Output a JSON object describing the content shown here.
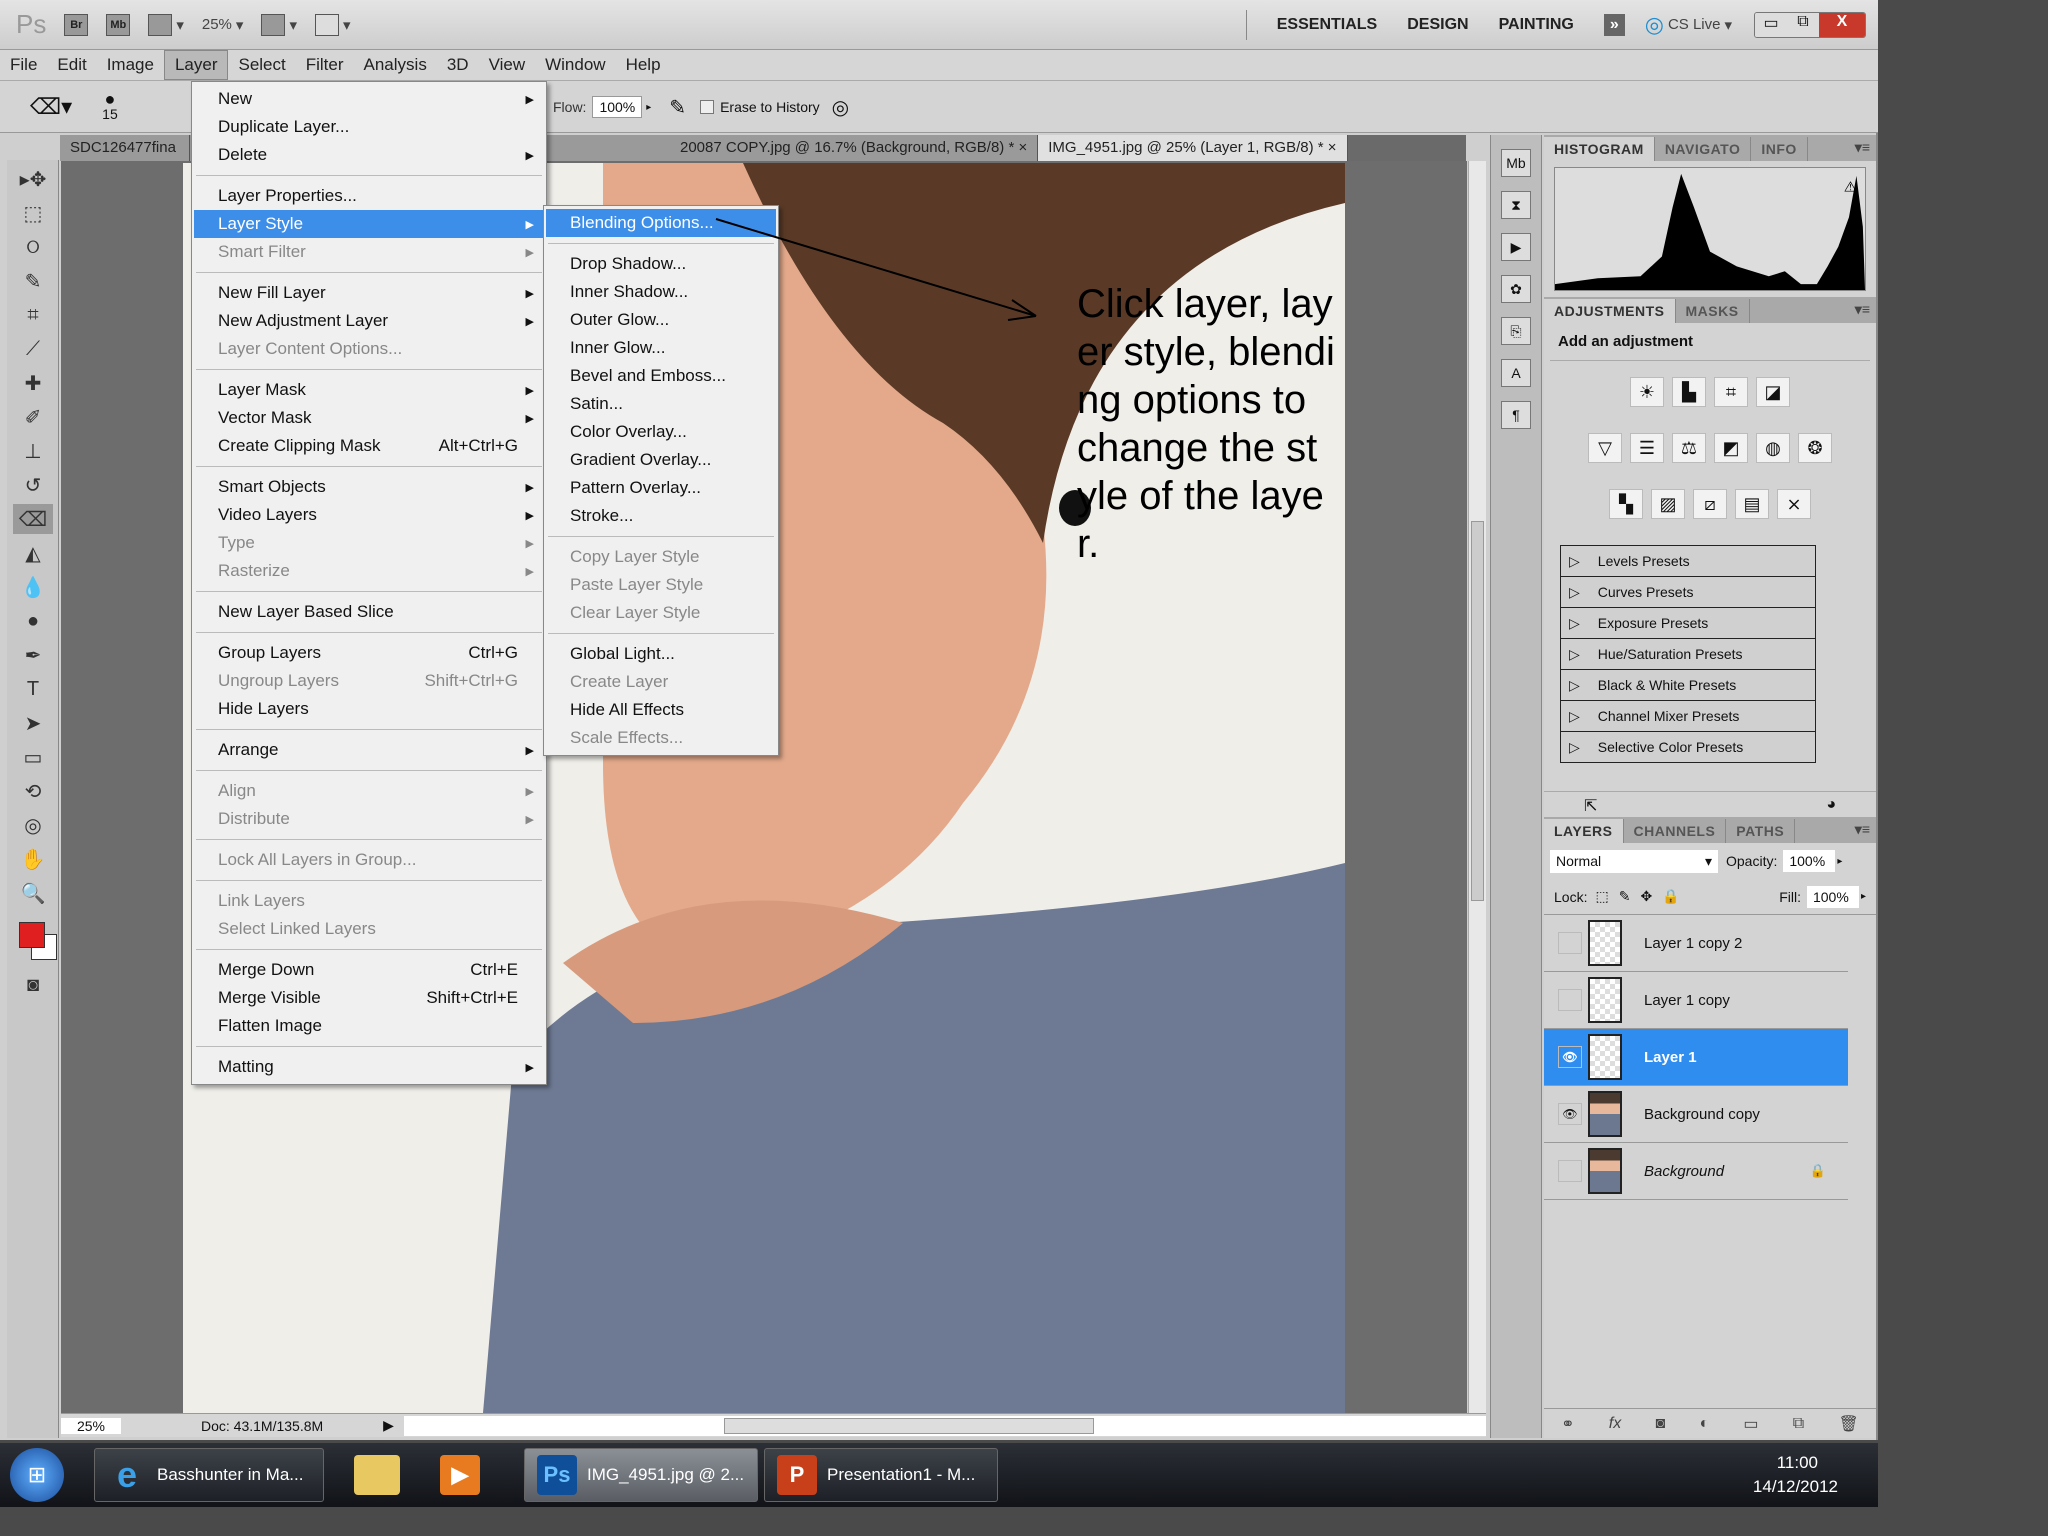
{
  "appbar": {
    "logo": "Ps",
    "bridge": "Br",
    "minibridge": "Mb",
    "zoom": "25%",
    "workspaces": [
      "ESSENTIALS",
      "DESIGN",
      "PAINTING"
    ],
    "more": "»",
    "cslive": "CS Live",
    "win_min": "▭",
    "win_restore": "⧉",
    "win_close": "X"
  },
  "menubar": [
    "File",
    "Edit",
    "Image",
    "Layer",
    "Select",
    "Filter",
    "Analysis",
    "3D",
    "View",
    "Window",
    "Help"
  ],
  "options": {
    "brush_size": "15",
    "flow_label": "Flow:",
    "flow_value": "100%",
    "erase_history": "Erase to History"
  },
  "tabs": [
    "SDC126477fina",
    "20087 COPY.jpg @ 16.7% (Background, RGB/8) *",
    "IMG_4951.jpg @ 25% (Layer 1, RGB/8) *"
  ],
  "tab_close": "×",
  "layer_menu": [
    {
      "label": "New",
      "sub": true
    },
    {
      "label": "Duplicate Layer..."
    },
    {
      "label": "Delete",
      "sub": true
    },
    {
      "sep": true
    },
    {
      "label": "Layer Properties..."
    },
    {
      "label": "Layer Style",
      "sub": true,
      "hl": true
    },
    {
      "label": "Smart Filter",
      "sub": true,
      "dis": true
    },
    {
      "sep": true
    },
    {
      "label": "New Fill Layer",
      "sub": true
    },
    {
      "label": "New Adjustment Layer",
      "sub": true
    },
    {
      "label": "Layer Content Options...",
      "dis": true
    },
    {
      "sep": true
    },
    {
      "label": "Layer Mask",
      "sub": true
    },
    {
      "label": "Vector Mask",
      "sub": true
    },
    {
      "label": "Create Clipping Mask",
      "shortcut": "Alt+Ctrl+G"
    },
    {
      "sep": true
    },
    {
      "label": "Smart Objects",
      "sub": true
    },
    {
      "label": "Video Layers",
      "sub": true
    },
    {
      "label": "Type",
      "sub": true,
      "dis": true
    },
    {
      "label": "Rasterize",
      "sub": true,
      "dis": true
    },
    {
      "sep": true
    },
    {
      "label": "New Layer Based Slice"
    },
    {
      "sep": true
    },
    {
      "label": "Group Layers",
      "shortcut": "Ctrl+G"
    },
    {
      "label": "Ungroup Layers",
      "shortcut": "Shift+Ctrl+G",
      "dis": true
    },
    {
      "label": "Hide Layers"
    },
    {
      "sep": true
    },
    {
      "label": "Arrange",
      "sub": true
    },
    {
      "sep": true
    },
    {
      "label": "Align",
      "sub": true,
      "dis": true
    },
    {
      "label": "Distribute",
      "sub": true,
      "dis": true
    },
    {
      "sep": true
    },
    {
      "label": "Lock All Layers in Group...",
      "dis": true
    },
    {
      "sep": true
    },
    {
      "label": "Link Layers",
      "dis": true
    },
    {
      "label": "Select Linked Layers",
      "dis": true
    },
    {
      "sep": true
    },
    {
      "label": "Merge Down",
      "shortcut": "Ctrl+E"
    },
    {
      "label": "Merge Visible",
      "shortcut": "Shift+Ctrl+E"
    },
    {
      "label": "Flatten Image"
    },
    {
      "sep": true
    },
    {
      "label": "Matting",
      "sub": true
    }
  ],
  "style_menu": [
    {
      "label": "Blending Options...",
      "hl": true
    },
    {
      "sep": true
    },
    {
      "label": "Drop Shadow..."
    },
    {
      "label": "Inner Shadow..."
    },
    {
      "label": "Outer Glow..."
    },
    {
      "label": "Inner Glow..."
    },
    {
      "label": "Bevel and Emboss..."
    },
    {
      "label": "Satin..."
    },
    {
      "label": "Color Overlay..."
    },
    {
      "label": "Gradient Overlay..."
    },
    {
      "label": "Pattern Overlay..."
    },
    {
      "label": "Stroke..."
    },
    {
      "sep": true
    },
    {
      "label": "Copy Layer Style",
      "dis": true
    },
    {
      "label": "Paste Layer Style",
      "dis": true
    },
    {
      "label": "Clear Layer Style",
      "dis": true
    },
    {
      "sep": true
    },
    {
      "label": "Global Light..."
    },
    {
      "label": "Create Layer",
      "dis": true
    },
    {
      "label": "Hide All Effects"
    },
    {
      "label": "Scale Effects...",
      "dis": true
    }
  ],
  "annotation": "Click layer, layer style, blending options to change the style of the layer.",
  "status": {
    "zoom": "25%",
    "doc": "Doc: 43.1M/135.8M"
  },
  "histogram_tabs": [
    "HISTOGRAM",
    "NAVIGATO",
    "INFO"
  ],
  "adjust_tabs": [
    "ADJUSTMENTS",
    "MASKS"
  ],
  "adjust_title": "Add an adjustment",
  "presets": [
    "Levels Presets",
    "Curves Presets",
    "Exposure Presets",
    "Hue/Saturation Presets",
    "Black & White Presets",
    "Channel Mixer Presets",
    "Selective Color Presets"
  ],
  "layers_panel": {
    "tabs": [
      "LAYERS",
      "CHANNELS",
      "PATHS"
    ],
    "blend_mode": "Normal",
    "opacity_label": "Opacity:",
    "opacity": "100%",
    "lock_label": "Lock:",
    "fill_label": "Fill:",
    "fill": "100%",
    "layers": [
      {
        "name": "Layer 1 copy 2",
        "visible": false
      },
      {
        "name": "Layer 1 copy",
        "visible": false
      },
      {
        "name": "Layer 1",
        "visible": true,
        "selected": true
      },
      {
        "name": "Background copy",
        "visible": true,
        "photo": true
      },
      {
        "name": "Background",
        "visible": false,
        "photo": true,
        "locked": true
      }
    ]
  },
  "taskbar": {
    "items": [
      {
        "label": "Basshunter in Ma...",
        "icon": "e"
      },
      {
        "label": "IMG_4951.jpg @ 2...",
        "icon": "Ps",
        "active": true
      },
      {
        "label": "Presentation1 - M...",
        "icon": "P"
      }
    ],
    "time": "11:00",
    "date": "14/12/2012"
  },
  "colors": {
    "foreground": "#e02020",
    "background": "#ffffff",
    "highlight": "#3d8ee8",
    "layer_selected": "#2f8df0"
  }
}
